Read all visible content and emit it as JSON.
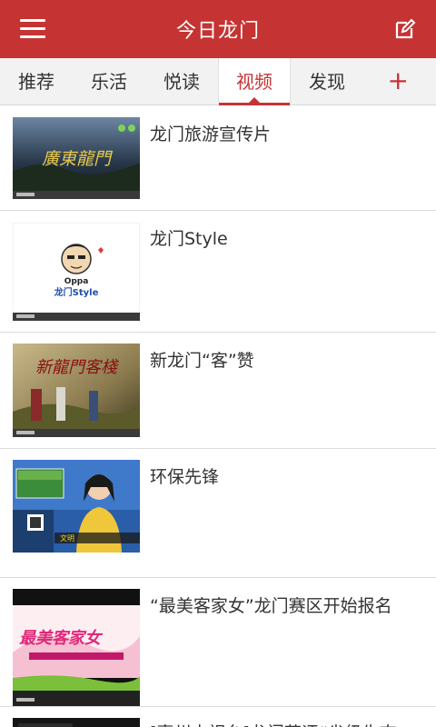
{
  "header": {
    "title": "今日龙门"
  },
  "tabs": [
    {
      "label": "推荐"
    },
    {
      "label": "乐活"
    },
    {
      "label": "悦读"
    },
    {
      "label": "视频"
    },
    {
      "label": "发现"
    }
  ],
  "active_tab": "视频",
  "add_tab_label": "+",
  "thumb_text": {
    "t1": "廣東龍門",
    "t2_top": "Oppa",
    "t2_bottom": "龙门Style",
    "t3": "新龍門客棧",
    "t4_badge": "文明",
    "t5": "最美客家女"
  },
  "videos": [
    {
      "title": "龙门旅游宣传片"
    },
    {
      "title": "龙门Style"
    },
    {
      "title": "新龙门“客”赞"
    },
    {
      "title": "环保先锋"
    },
    {
      "title": "“最美客家女”龙门赛区开始报名"
    },
    {
      "title": "[惠州电视台]龙门获评“省级生态"
    }
  ],
  "colors": {
    "brand": "#c63333",
    "tabbar_bg": "#f2f2f2"
  }
}
